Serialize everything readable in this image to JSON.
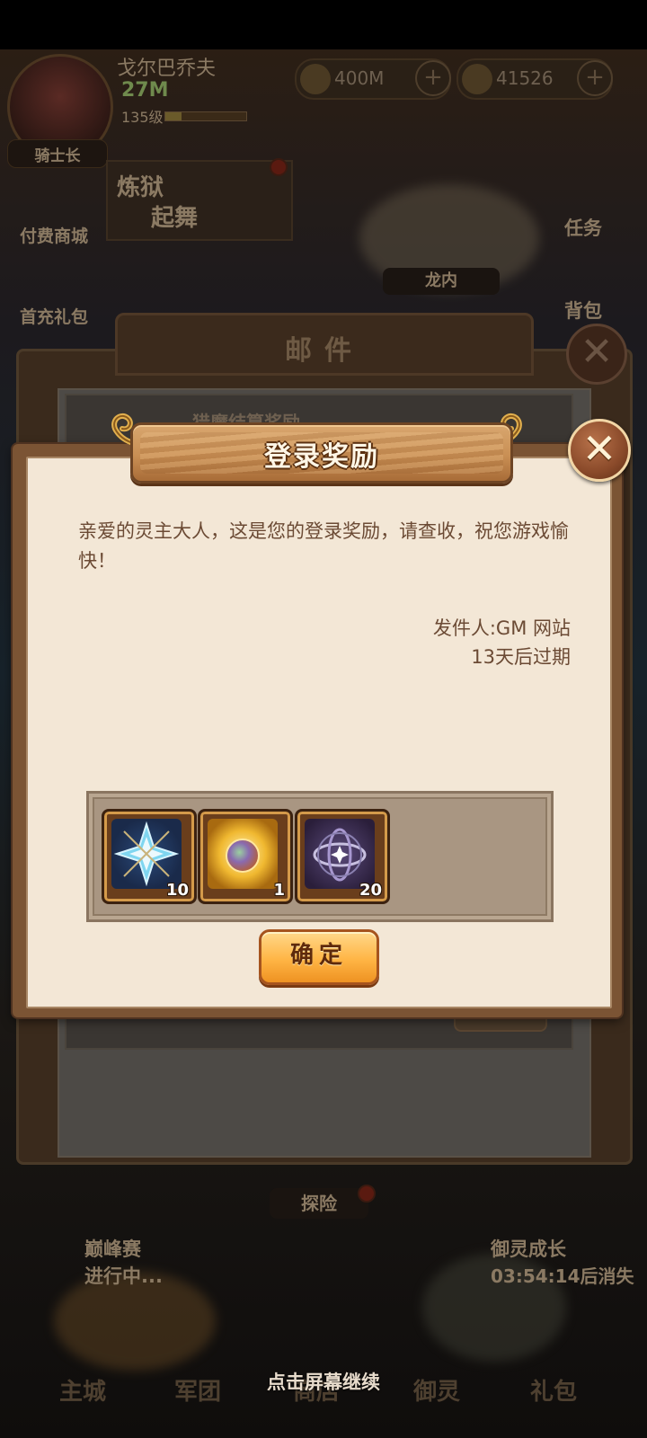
{
  "hud": {
    "player_name": "戈尔巴乔夫",
    "power": "27M",
    "level": "135级",
    "level_progress": 0.2,
    "gold": "400M",
    "gems": "41526",
    "plus": "+",
    "rank_title": "骑士长"
  },
  "background": {
    "left_buttons": [
      "付费商城",
      "首充礼包"
    ],
    "right_buttons": [
      "任务",
      "背包"
    ],
    "event_banner": [
      "炼狱",
      "起舞"
    ],
    "center_label": "龙内",
    "lower_label": "探险",
    "peak_event": {
      "title": "巅峰赛",
      "status": "进行中..."
    },
    "growth_event": {
      "title": "御灵成长",
      "timer": "03:54:14后消失"
    },
    "bottom_nav": [
      "主城",
      "军团",
      "商店",
      "御灵",
      "礼包"
    ]
  },
  "mail_window": {
    "title": "邮件",
    "item_title": "猎魔结算奖励",
    "close_symbol": "✕"
  },
  "dialog": {
    "title": "登录奖励",
    "message": "亲爱的灵主大人，这是您的登录奖励，请查收，祝您游戏愉快！",
    "sender": "发件人:GM 网站",
    "expiry": "13天后过期",
    "close_symbol": "✕",
    "confirm_label": "确定",
    "rewards": [
      {
        "icon": "star-compass-icon",
        "count": "10",
        "color": "#4db4d8"
      },
      {
        "icon": "golden-orb-icon",
        "count": "1",
        "color": "#e8b030"
      },
      {
        "icon": "armillary-sphere-icon",
        "count": "20",
        "color": "#8a7ab8"
      }
    ]
  },
  "hint": "点击屏幕继续"
}
